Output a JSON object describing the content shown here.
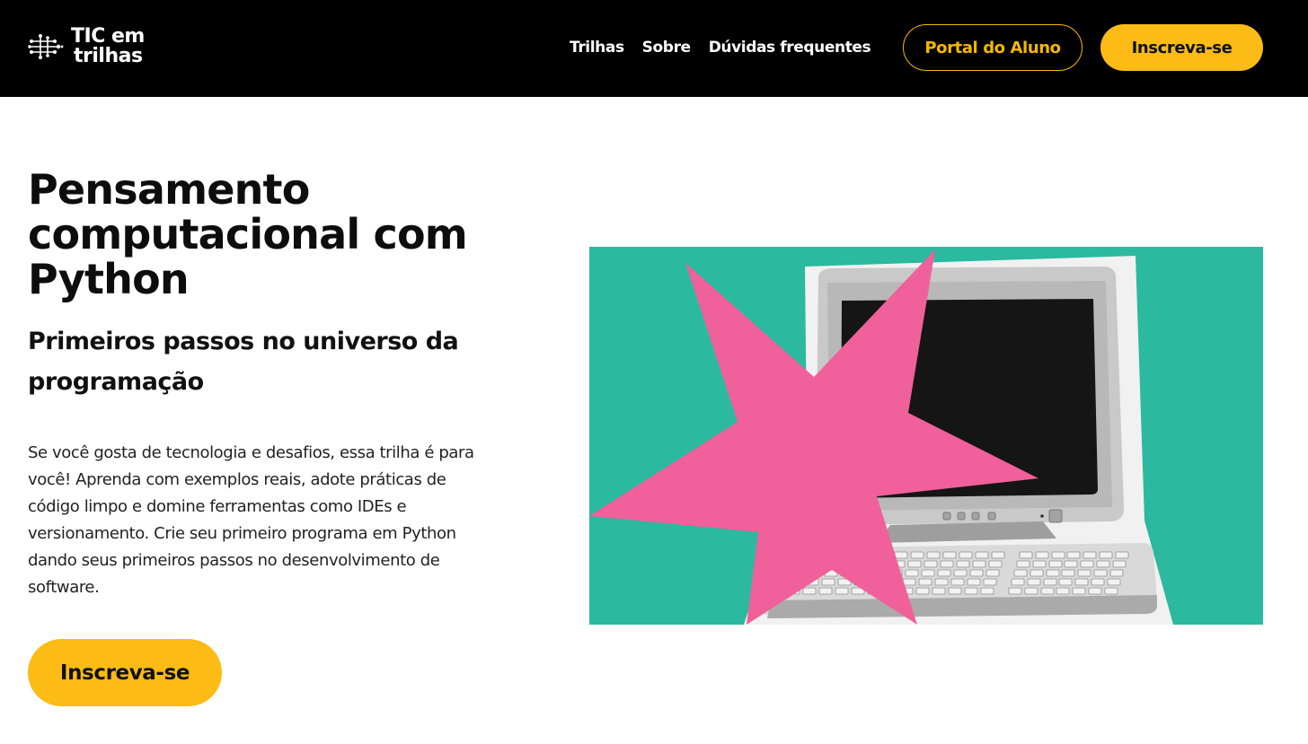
{
  "header": {
    "logo": {
      "line1": "TIC em",
      "line2": "trilhas",
      "icon": "circuit-dots-icon"
    },
    "nav": [
      {
        "label": "Trilhas"
      },
      {
        "label": "Sobre"
      },
      {
        "label": "Dúvidas frequentes"
      }
    ],
    "portal_label": "Portal do Aluno",
    "signup_label": "Inscreva-se"
  },
  "hero": {
    "title": "Pensamento computacional com Python",
    "subtitle": "Primeiros passos no universo da programação",
    "description": "Se você gosta de tecnologia e desafios, essa trilha é para você! Aprenda com exemplos reais, adote práticas de código limpo e domine ferramentas como IDEs e versionamento. Crie seu primeiro programa em Python dando seus primeiros passos no desenvolvimento de software.",
    "cta_label": "Inscreva-se",
    "image": {
      "icon": "retro-computer-illustration"
    }
  },
  "colors": {
    "header_bg": "#000000",
    "accent_yellow": "#fdbb16",
    "outline_yellow": "#f5b800",
    "image_teal": "#2bb9a0",
    "star_pink": "#f0609a"
  }
}
